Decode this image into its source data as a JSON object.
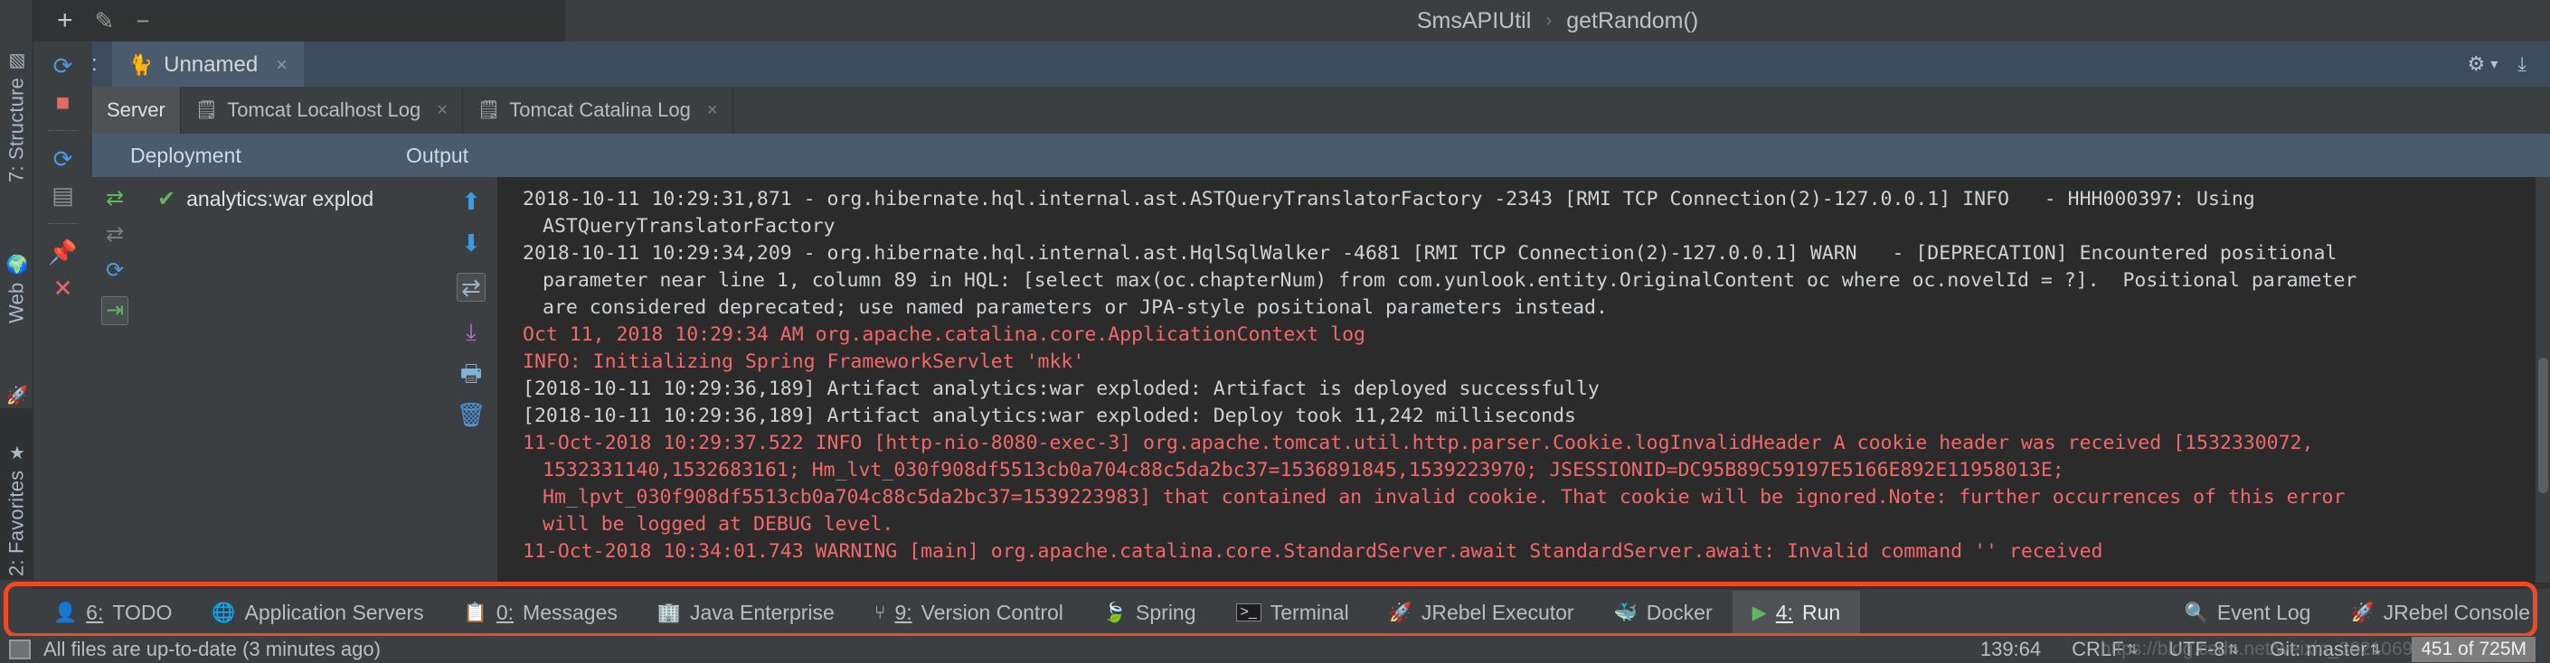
{
  "toolbar": {
    "add_label": "+",
    "edit_label": "✎",
    "remove_label": "−"
  },
  "breadcrumb": {
    "class_name": "SmsAPIUtil",
    "separator": "›",
    "method_name": "getRandom()"
  },
  "run_panel": {
    "label": "Run:",
    "tab_name": "Unnamed",
    "tab_icon": "tomcat-icon",
    "close_label": "×",
    "settings_icon": "gear-icon",
    "settings_caret": "▾",
    "pin_icon": "download-icon"
  },
  "subtabs": [
    {
      "label": "Server",
      "icon": "",
      "active": true,
      "closable": false
    },
    {
      "label": "Tomcat Localhost Log",
      "icon": "log-file-icon",
      "active": false,
      "closable": true
    },
    {
      "label": "Tomcat Catalina Log",
      "icon": "log-file-icon",
      "active": false,
      "closable": true
    }
  ],
  "panel_headers": {
    "deployment": "Deployment",
    "output": "Output"
  },
  "deployment": {
    "artifact": "analytics:war explod",
    "status_icon": "success-check-icon"
  },
  "run_gutter_icons": [
    "rerun-icon",
    "stop-icon",
    "rerun-blue-icon",
    "settings-screen-icon",
    "pin-icon",
    "close-icon"
  ],
  "deploy_gutter_icons": [
    "deploy-all-icon",
    "undeploy-icon",
    "redeploy-icon",
    "update-icon"
  ],
  "console_gutter_icons": [
    "up-arrow-icon",
    "down-arrow-icon",
    "soft-wrap-icon",
    "scroll-to-end-icon",
    "print-icon",
    "trash-icon"
  ],
  "console_lines": [
    {
      "color": "gray",
      "indent": 0,
      "text": "2018-10-11 10:29:31,871 - org.hibernate.hql.internal.ast.ASTQueryTranslatorFactory -2343 [RMI TCP Connection(2)-127.0.0.1] INFO   - HHH000397: Using"
    },
    {
      "color": "gray",
      "indent": 1,
      "text": "ASTQueryTranslatorFactory"
    },
    {
      "color": "gray",
      "indent": 0,
      "text": "2018-10-11 10:29:34,209 - org.hibernate.hql.internal.ast.HqlSqlWalker -4681 [RMI TCP Connection(2)-127.0.0.1] WARN   - [DEPRECATION] Encountered positional"
    },
    {
      "color": "gray",
      "indent": 1,
      "text": "parameter near line 1, column 89 in HQL: [select max(oc.chapterNum) from com.yunlook.entity.OriginalContent oc where oc.novelId = ?].  Positional parameter"
    },
    {
      "color": "gray",
      "indent": 1,
      "text": "are considered deprecated; use named parameters or JPA-style positional parameters instead."
    },
    {
      "color": "red",
      "indent": 0,
      "text": "Oct 11, 2018 10:29:34 AM org.apache.catalina.core.ApplicationContext log"
    },
    {
      "color": "red",
      "indent": 0,
      "text": "INFO: Initializing Spring FrameworkServlet 'mkk'"
    },
    {
      "color": "gray",
      "indent": 0,
      "text": "[2018-10-11 10:29:36,189] Artifact analytics:war exploded: Artifact is deployed successfully"
    },
    {
      "color": "gray",
      "indent": 0,
      "text": "[2018-10-11 10:29:36,189] Artifact analytics:war exploded: Deploy took 11,242 milliseconds"
    },
    {
      "color": "red",
      "indent": 0,
      "text": "11-Oct-2018 10:29:37.522 INFO [http-nio-8080-exec-3] org.apache.tomcat.util.http.parser.Cookie.logInvalidHeader A cookie header was received [1532330072,"
    },
    {
      "color": "red",
      "indent": 1,
      "text": "1532331140,1532683161; Hm_lvt_030f908df5513cb0a704c88c5da2bc37=1536891845,1539223970; JSESSIONID=DC95B89C59197E5166E892E11958013E;"
    },
    {
      "color": "red",
      "indent": 1,
      "text": "Hm_lpvt_030f908df5513cb0a704c88c5da2bc37=1539223983] that contained an invalid cookie. That cookie will be ignored.Note: further occurrences of this error"
    },
    {
      "color": "red",
      "indent": 1,
      "text": "will be logged at DEBUG level."
    },
    {
      "color": "red",
      "indent": 0,
      "text": "11-Oct-2018 10:34:01.743 WARNING [main] org.apache.catalina.core.StandardServer.await StandardServer.await: Invalid command '' received"
    }
  ],
  "left_sidebar": [
    {
      "label": "7: Structure",
      "icon": "structure-icon",
      "selected": false
    },
    {
      "label": "Web",
      "icon": "web-globe-icon",
      "selected": false
    },
    {
      "label": "JRebel",
      "icon": "jrebel-rocket-icon",
      "selected": false
    },
    {
      "label": "2: Favorites",
      "icon": "star-icon",
      "selected": false
    }
  ],
  "bottom_toolbar": {
    "items": [
      {
        "mnemonic": "6:",
        "label": "TODO",
        "icon": "todo-icon",
        "active": false
      },
      {
        "mnemonic": "",
        "label": "Application Servers",
        "icon": "app-servers-icon",
        "active": false
      },
      {
        "mnemonic": "0:",
        "label": "Messages",
        "icon": "messages-icon",
        "active": false
      },
      {
        "mnemonic": "",
        "label": "Java Enterprise",
        "icon": "java-enterprise-icon",
        "active": false
      },
      {
        "mnemonic": "9:",
        "label": "Version Control",
        "icon": "version-control-icon",
        "active": false
      },
      {
        "mnemonic": "",
        "label": "Spring",
        "icon": "spring-leaf-icon",
        "active": false
      },
      {
        "mnemonic": "",
        "label": "Terminal",
        "icon": "terminal-icon",
        "active": false
      },
      {
        "mnemonic": "",
        "label": "JRebel Executor",
        "icon": "jrebel-rocket-icon",
        "active": false
      },
      {
        "mnemonic": "",
        "label": "Docker",
        "icon": "docker-whale-icon",
        "active": false
      },
      {
        "mnemonic": "4:",
        "label": "Run",
        "icon": "run-play-icon",
        "active": true
      }
    ],
    "right_items": [
      {
        "label": "Event Log",
        "icon": "event-log-icon"
      },
      {
        "label": "JRebel Console",
        "icon": "jrebel-rocket-icon"
      }
    ],
    "highlight_color": "#ef4a23"
  },
  "status_bar": {
    "message": "All files are up-to-date (3 minutes ago)",
    "caret_position": "139:64",
    "line_separator": "CRLF",
    "encoding": "UTF-8",
    "branch": "Git: master",
    "memory": "451 of 725M",
    "watermark": "https://blog.csdn.net/weixin_36210698"
  }
}
